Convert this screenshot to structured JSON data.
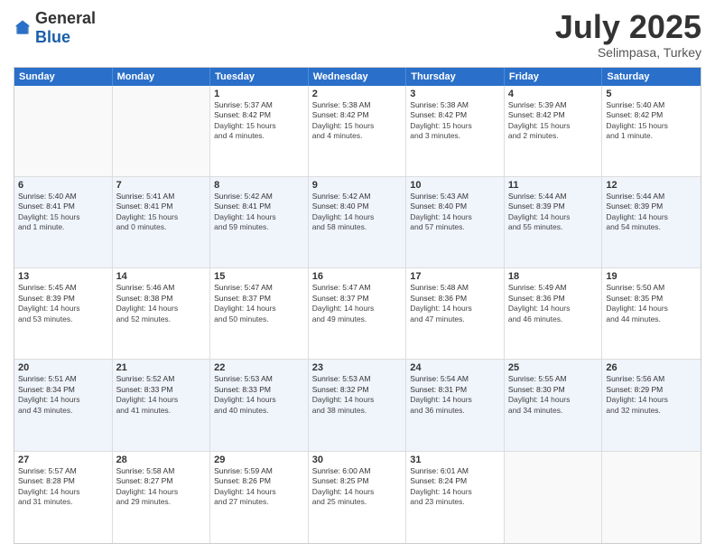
{
  "logo": {
    "general": "General",
    "blue": "Blue"
  },
  "title": "July 2025",
  "subtitle": "Selimpasa, Turkey",
  "weekdays": [
    "Sunday",
    "Monday",
    "Tuesday",
    "Wednesday",
    "Thursday",
    "Friday",
    "Saturday"
  ],
  "weeks": [
    [
      {
        "day": "",
        "info": ""
      },
      {
        "day": "",
        "info": ""
      },
      {
        "day": "1",
        "info": "Sunrise: 5:37 AM\nSunset: 8:42 PM\nDaylight: 15 hours\nand 4 minutes."
      },
      {
        "day": "2",
        "info": "Sunrise: 5:38 AM\nSunset: 8:42 PM\nDaylight: 15 hours\nand 4 minutes."
      },
      {
        "day": "3",
        "info": "Sunrise: 5:38 AM\nSunset: 8:42 PM\nDaylight: 15 hours\nand 3 minutes."
      },
      {
        "day": "4",
        "info": "Sunrise: 5:39 AM\nSunset: 8:42 PM\nDaylight: 15 hours\nand 2 minutes."
      },
      {
        "day": "5",
        "info": "Sunrise: 5:40 AM\nSunset: 8:42 PM\nDaylight: 15 hours\nand 1 minute."
      }
    ],
    [
      {
        "day": "6",
        "info": "Sunrise: 5:40 AM\nSunset: 8:41 PM\nDaylight: 15 hours\nand 1 minute."
      },
      {
        "day": "7",
        "info": "Sunrise: 5:41 AM\nSunset: 8:41 PM\nDaylight: 15 hours\nand 0 minutes."
      },
      {
        "day": "8",
        "info": "Sunrise: 5:42 AM\nSunset: 8:41 PM\nDaylight: 14 hours\nand 59 minutes."
      },
      {
        "day": "9",
        "info": "Sunrise: 5:42 AM\nSunset: 8:40 PM\nDaylight: 14 hours\nand 58 minutes."
      },
      {
        "day": "10",
        "info": "Sunrise: 5:43 AM\nSunset: 8:40 PM\nDaylight: 14 hours\nand 57 minutes."
      },
      {
        "day": "11",
        "info": "Sunrise: 5:44 AM\nSunset: 8:39 PM\nDaylight: 14 hours\nand 55 minutes."
      },
      {
        "day": "12",
        "info": "Sunrise: 5:44 AM\nSunset: 8:39 PM\nDaylight: 14 hours\nand 54 minutes."
      }
    ],
    [
      {
        "day": "13",
        "info": "Sunrise: 5:45 AM\nSunset: 8:39 PM\nDaylight: 14 hours\nand 53 minutes."
      },
      {
        "day": "14",
        "info": "Sunrise: 5:46 AM\nSunset: 8:38 PM\nDaylight: 14 hours\nand 52 minutes."
      },
      {
        "day": "15",
        "info": "Sunrise: 5:47 AM\nSunset: 8:37 PM\nDaylight: 14 hours\nand 50 minutes."
      },
      {
        "day": "16",
        "info": "Sunrise: 5:47 AM\nSunset: 8:37 PM\nDaylight: 14 hours\nand 49 minutes."
      },
      {
        "day": "17",
        "info": "Sunrise: 5:48 AM\nSunset: 8:36 PM\nDaylight: 14 hours\nand 47 minutes."
      },
      {
        "day": "18",
        "info": "Sunrise: 5:49 AM\nSunset: 8:36 PM\nDaylight: 14 hours\nand 46 minutes."
      },
      {
        "day": "19",
        "info": "Sunrise: 5:50 AM\nSunset: 8:35 PM\nDaylight: 14 hours\nand 44 minutes."
      }
    ],
    [
      {
        "day": "20",
        "info": "Sunrise: 5:51 AM\nSunset: 8:34 PM\nDaylight: 14 hours\nand 43 minutes."
      },
      {
        "day": "21",
        "info": "Sunrise: 5:52 AM\nSunset: 8:33 PM\nDaylight: 14 hours\nand 41 minutes."
      },
      {
        "day": "22",
        "info": "Sunrise: 5:53 AM\nSunset: 8:33 PM\nDaylight: 14 hours\nand 40 minutes."
      },
      {
        "day": "23",
        "info": "Sunrise: 5:53 AM\nSunset: 8:32 PM\nDaylight: 14 hours\nand 38 minutes."
      },
      {
        "day": "24",
        "info": "Sunrise: 5:54 AM\nSunset: 8:31 PM\nDaylight: 14 hours\nand 36 minutes."
      },
      {
        "day": "25",
        "info": "Sunrise: 5:55 AM\nSunset: 8:30 PM\nDaylight: 14 hours\nand 34 minutes."
      },
      {
        "day": "26",
        "info": "Sunrise: 5:56 AM\nSunset: 8:29 PM\nDaylight: 14 hours\nand 32 minutes."
      }
    ],
    [
      {
        "day": "27",
        "info": "Sunrise: 5:57 AM\nSunset: 8:28 PM\nDaylight: 14 hours\nand 31 minutes."
      },
      {
        "day": "28",
        "info": "Sunrise: 5:58 AM\nSunset: 8:27 PM\nDaylight: 14 hours\nand 29 minutes."
      },
      {
        "day": "29",
        "info": "Sunrise: 5:59 AM\nSunset: 8:26 PM\nDaylight: 14 hours\nand 27 minutes."
      },
      {
        "day": "30",
        "info": "Sunrise: 6:00 AM\nSunset: 8:25 PM\nDaylight: 14 hours\nand 25 minutes."
      },
      {
        "day": "31",
        "info": "Sunrise: 6:01 AM\nSunset: 8:24 PM\nDaylight: 14 hours\nand 23 minutes."
      },
      {
        "day": "",
        "info": ""
      },
      {
        "day": "",
        "info": ""
      }
    ]
  ],
  "altRows": [
    1,
    3
  ]
}
